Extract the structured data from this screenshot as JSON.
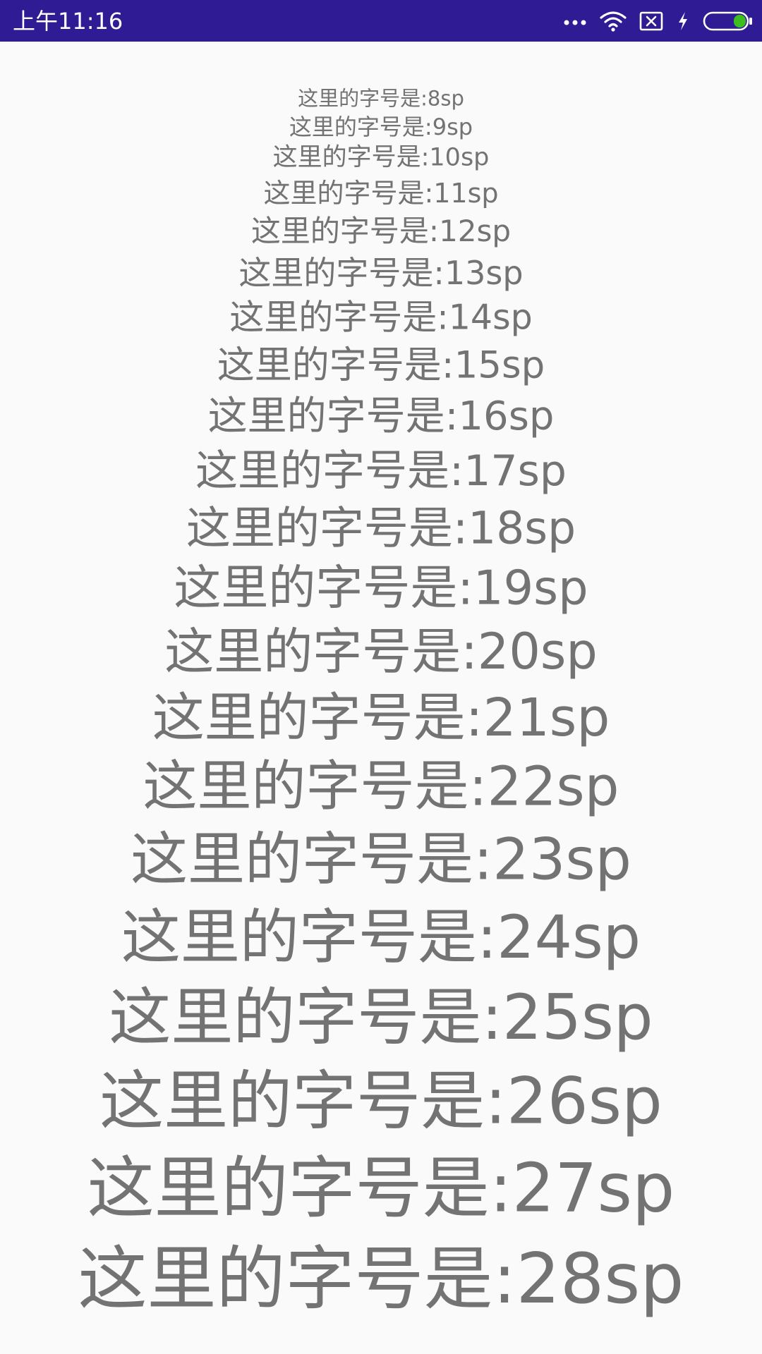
{
  "status_bar": {
    "time": "上午11:16",
    "background_color": "#2f1b94",
    "icons": [
      "more-dots-icon",
      "wifi-icon",
      "sim-x-icon",
      "charging-bolt-icon",
      "battery-icon"
    ],
    "battery_color": "#3cbe1e"
  },
  "lines": [
    "这里的字号是:8sp",
    "这里的字号是:9sp",
    "这里的字号是:10sp",
    "这里的字号是:11sp",
    "这里的字号是:12sp",
    "这里的字号是:13sp",
    "这里的字号是:14sp",
    "这里的字号是:15sp",
    "这里的字号是:16sp",
    "这里的字号是:17sp",
    "这里的字号是:18sp",
    "这里的字号是:19sp",
    "这里的字号是:20sp",
    "这里的字号是:21sp",
    "这里的字号是:22sp",
    "这里的字号是:23sp",
    "这里的字号是:24sp",
    "这里的字号是:25sp",
    "这里的字号是:26sp",
    "这里的字号是:27sp",
    "这里的字号是:28sp"
  ],
  "text_color": "#737373"
}
